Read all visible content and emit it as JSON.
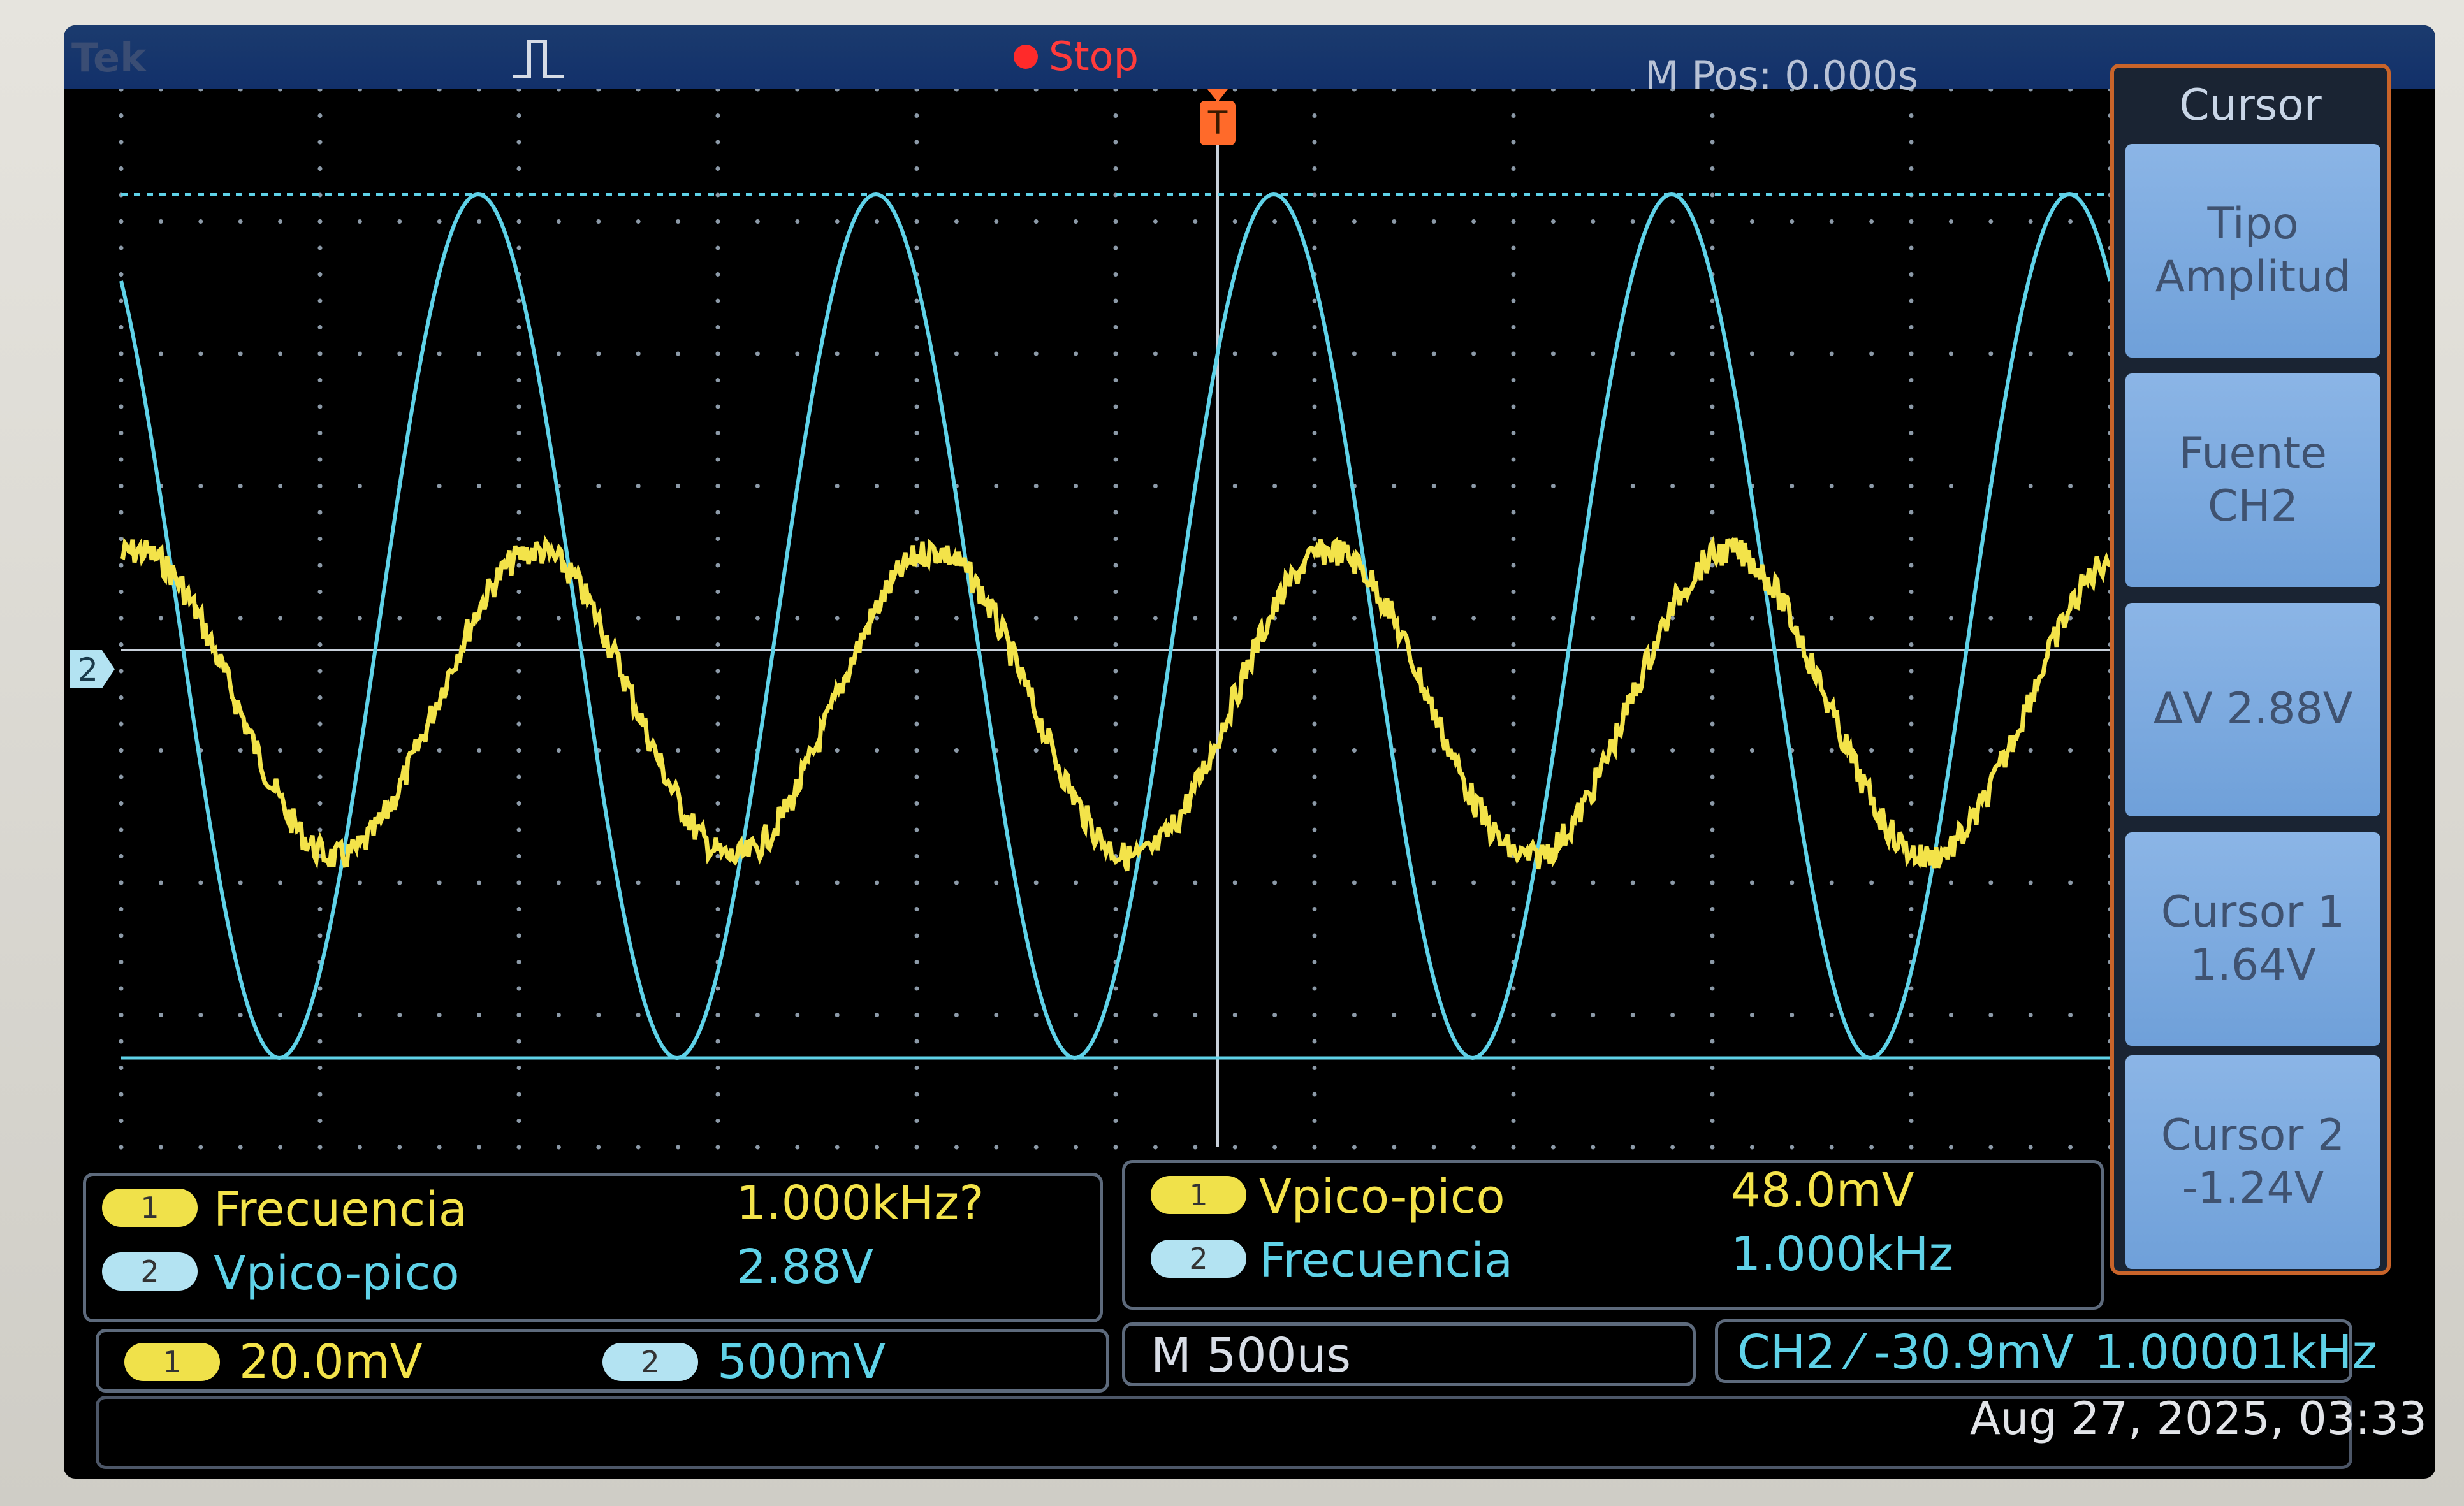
{
  "header": {
    "brand": "Tek",
    "acquisition_status": "Stop",
    "horizontal_position_label": "M Pos: 0.000s",
    "trigger_marker": "T",
    "ch2_ground_marker": "2"
  },
  "side_menu": {
    "title": "Cursor",
    "buttons": [
      {
        "line1": "Tipo",
        "line2": "Amplitud"
      },
      {
        "line1": "Fuente",
        "line2": "CH2"
      },
      {
        "line1": "ΔV 2.88V",
        "line2": ""
      },
      {
        "line1": "Cursor 1",
        "line2": "1.64V"
      },
      {
        "line1": "Cursor 2",
        "line2": "-1.24V"
      }
    ]
  },
  "measurements_left": [
    {
      "channel": "1",
      "label": "Frecuencia",
      "value": "1.000kHz?"
    },
    {
      "channel": "2",
      "label": "Vpico-pico",
      "value": "2.88V"
    }
  ],
  "measurements_right": [
    {
      "channel": "1",
      "label": "Vpico-pico",
      "value": "48.0mV"
    },
    {
      "channel": "2",
      "label": "Frecuencia",
      "value": "1.000kHz"
    }
  ],
  "status_bar": {
    "ch1_badge": "1",
    "ch1_scale": "20.0mV",
    "ch2_badge": "2",
    "ch2_scale": "500mV",
    "timebase": "M 500us",
    "trigger": "CH2 ⁄ -30.9mV",
    "trigger_freq": "1.00001kHz",
    "datetime": "Aug 27, 2025, 03:33"
  },
  "colors": {
    "ch1_trace": "#f3e34a",
    "ch2_trace": "#5fd2e8",
    "menu_button": "#7aa9de",
    "menu_border": "#c9642a",
    "stop": "#ff2a2a"
  },
  "waveforms": {
    "ch1": {
      "frequency_khz": 1.0,
      "vpp_mv": 48.0,
      "noisy": true
    },
    "ch2": {
      "frequency_khz": 1.0,
      "vpp_v": 2.88
    }
  }
}
